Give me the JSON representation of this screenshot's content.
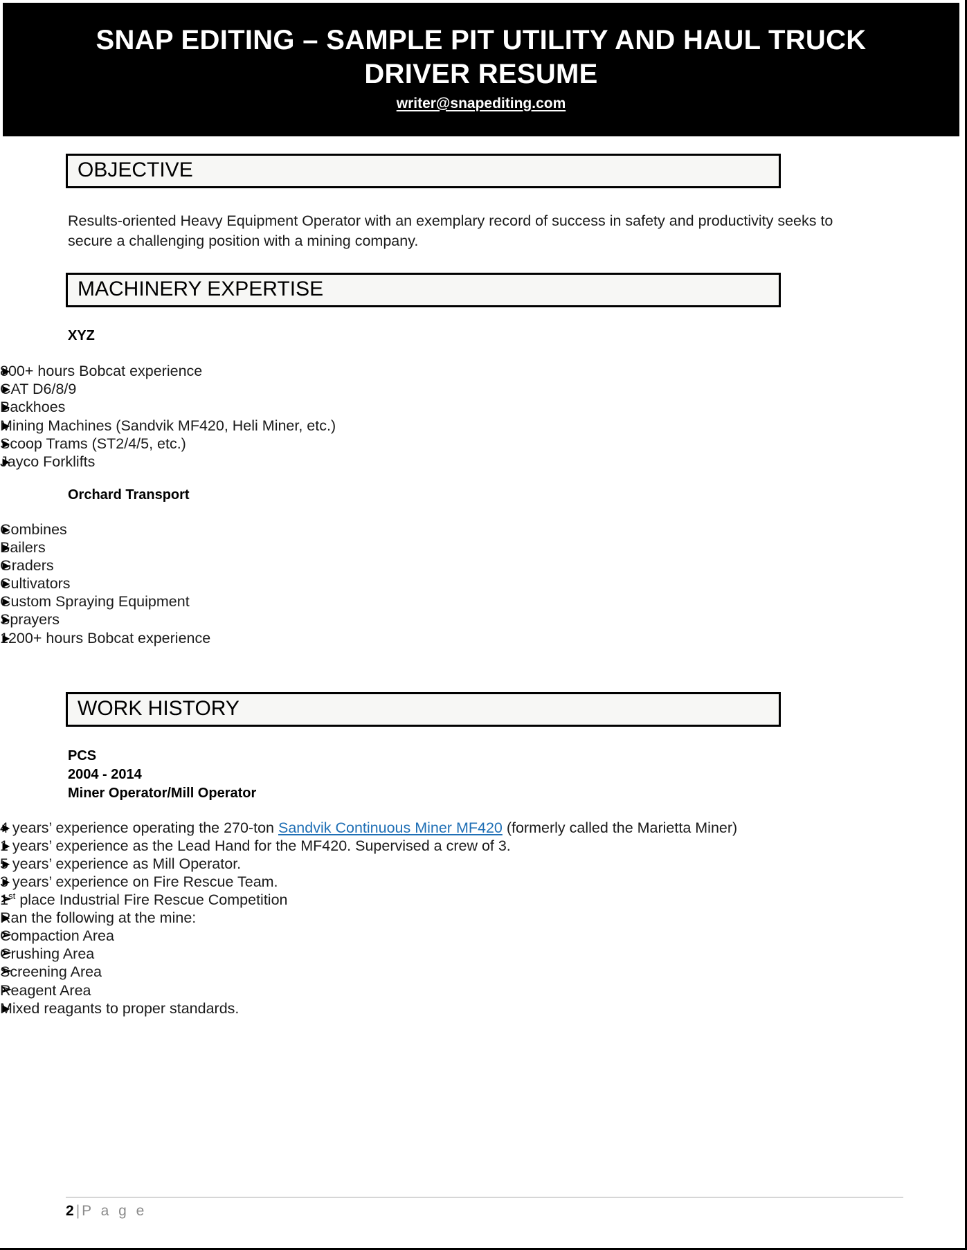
{
  "document": {
    "header": {
      "title": "SNAP EDITING – SAMPLE PIT UTILITY AND HAUL TRUCK DRIVER RESUME",
      "email": "writer@snapediting.com",
      "background_color": "#000000",
      "text_color": "#ffffff"
    },
    "sections": [
      {
        "id": "objective",
        "heading": "OBJECTIVE",
        "paragraph": "Results-oriented Heavy Equipment Operator with an exemplary record of success in safety and productivity seeks to secure a challenging position with a mining company."
      },
      {
        "id": "machinery-expertise",
        "heading": "MACHINERY EXPERTISE",
        "groups": [
          {
            "name": "XYZ",
            "items": [
              "800+ hours Bobcat experience",
              "CAT D6/8/9",
              "Backhoes",
              "Mining Machines (Sandvik MF420, Heli Miner, etc.)",
              "Scoop Trams (ST2/4/5, etc.)",
              "Jayco Forklifts"
            ]
          },
          {
            "name": "Orchard Transport",
            "items": [
              "Combines",
              "Bailers",
              "Graders",
              "Cultivators",
              "Custom Spraying Equipment",
              "Sprayers",
              "1200+ hours Bobcat experience"
            ]
          }
        ]
      },
      {
        "id": "work-history",
        "heading": "WORK HISTORY",
        "jobs": [
          {
            "employer": "PCS",
            "dates": "2004 - 2014",
            "title": "Miner Operator/Mill Operator",
            "bullets": [
              {
                "before_link": "4 years’ experience operating the 270-ton ",
                "link_text": "Sandvik Continuous Miner MF420",
                "after_link": " (formerly called the Marietta Miner)",
                "has_link": true
              },
              {
                "text": "1 years’ experience as the Lead Hand for the MF420. Supervised a crew of 3."
              },
              {
                "text": "5 years’ experience as Mill Operator."
              },
              {
                "text": "3 years’ experience on Fire Rescue Team.",
                "sub_items": [
                  {
                    "prefix": "1",
                    "sup": "st",
                    "suffix": " place Industrial Fire Rescue Competition"
                  }
                ]
              },
              {
                "text": "Ran the following at the mine:",
                "sub_items_plain": [
                  "Compaction Area",
                  "Crushing Area",
                  "Screening Area",
                  "Reagent Area"
                ]
              },
              {
                "text": "Mixed reagants to proper standards."
              }
            ]
          }
        ]
      }
    ],
    "footer": {
      "page_number": "2",
      "separator": "|",
      "page_word": "P a g e"
    },
    "glyphs": {
      "bullet_level1": "►",
      "bullet_level2": "➢"
    },
    "colors": {
      "link": "#1f6fb5",
      "section_bar_fill": "#f7f7f5",
      "section_bar_border": "#000000"
    }
  }
}
